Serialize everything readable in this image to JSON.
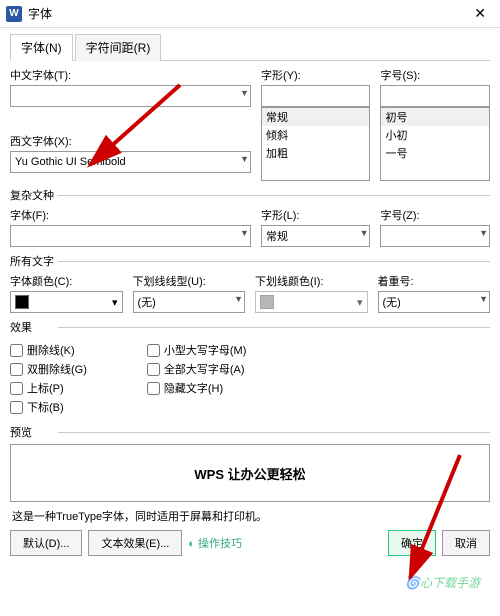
{
  "window": {
    "title": "字体",
    "app_icon": "W"
  },
  "tabs": {
    "font": "字体(N)",
    "spacing": "字符间距(R)"
  },
  "cjk_font": {
    "label": "中文字体(T):",
    "value": ""
  },
  "style": {
    "label": "字形(Y):",
    "options": [
      "常规",
      "倾斜",
      "加粗"
    ]
  },
  "size": {
    "label": "字号(S):",
    "options": [
      "初号",
      "小初",
      "一号"
    ]
  },
  "latin_font": {
    "label": "西文字体(X):",
    "value": "Yu Gothic UI Semibold"
  },
  "complex": {
    "section": "复杂文种",
    "font_label": "字体(F):",
    "font_value": "",
    "style_label": "字形(L):",
    "style_value": "常规",
    "size_label": "字号(Z):",
    "size_value": ""
  },
  "alltext": {
    "section": "所有文字",
    "color_label": "字体颜色(C):",
    "underline_label": "下划线线型(U):",
    "underline_value": "(无)",
    "ucolor_label": "下划线颜色(I):",
    "emphasis_label": "着重号:",
    "emphasis_value": "(无)"
  },
  "effects": {
    "section": "效果",
    "strike": "删除线(K)",
    "dstrike": "双删除线(G)",
    "super": "上标(P)",
    "sub": "下标(B)",
    "smallcaps": "小型大写字母(M)",
    "allcaps": "全部大写字母(A)",
    "hidden": "隐藏文字(H)"
  },
  "preview": {
    "section": "预览",
    "text": "WPS 让办公更轻松"
  },
  "hint": "这是一种TrueType字体，同时适用于屏幕和打印机。",
  "buttons": {
    "default": "默认(D)...",
    "texteffect": "文本效果(E)...",
    "ok": "确定",
    "cancel": "取消"
  }
}
